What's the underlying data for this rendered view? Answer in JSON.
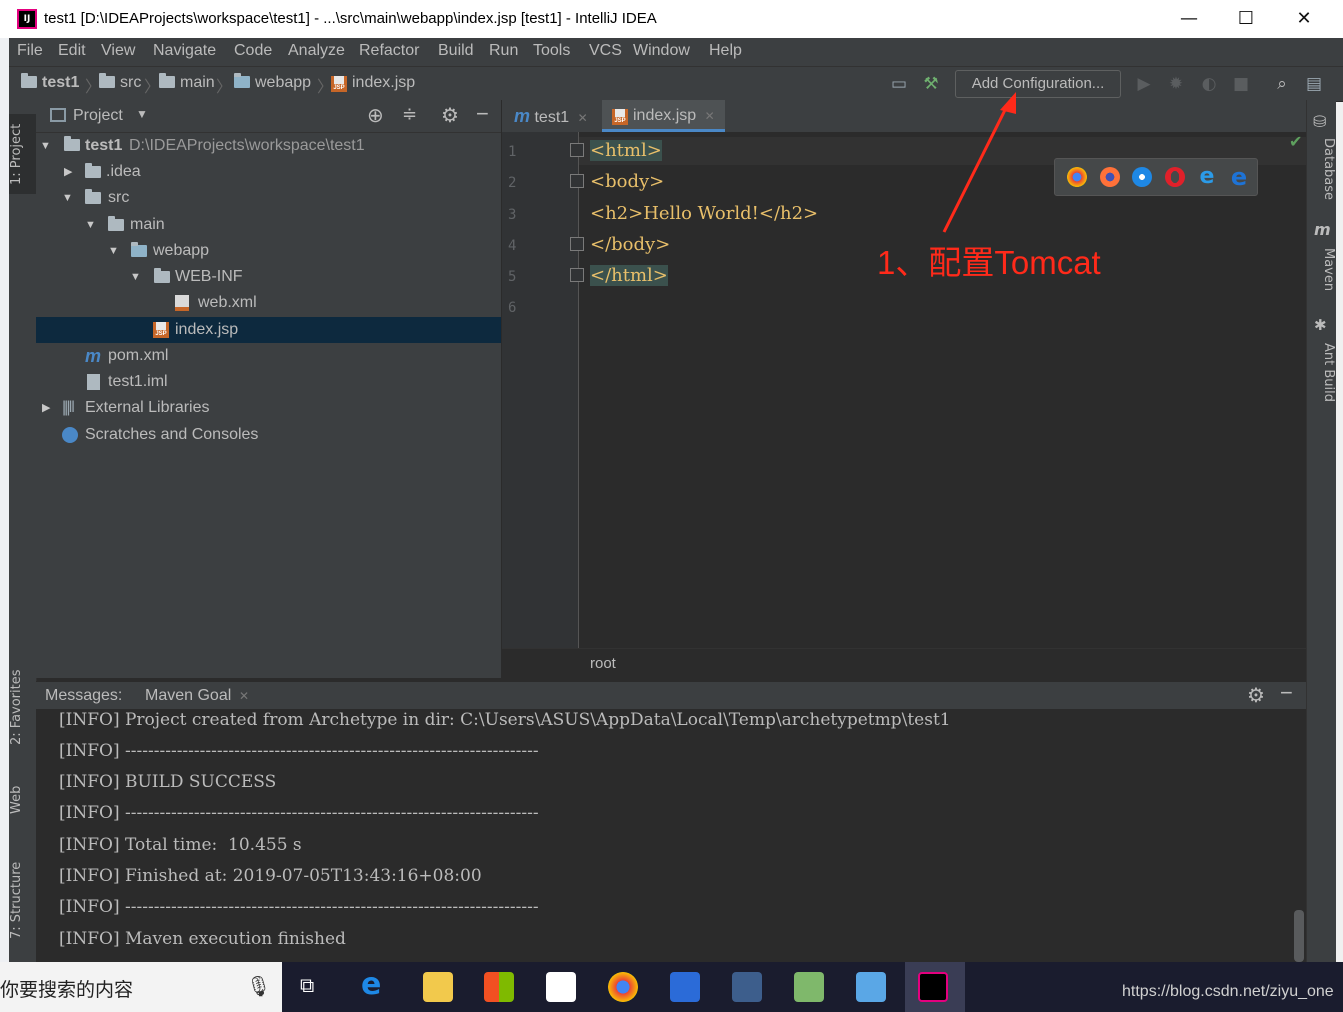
{
  "window": {
    "title": "test1 [D:\\IDEAProjects\\workspace\\test1] - ...\\src\\main\\webapp\\index.jsp [test1] - IntelliJ IDEA",
    "app_icon_label": "IJ",
    "minimize": "—",
    "maximize": "☐",
    "close": "✕"
  },
  "menu": [
    "File",
    "Edit",
    "View",
    "Navigate",
    "Code",
    "Analyze",
    "Refactor",
    "Build",
    "Run",
    "Tools",
    "VCS",
    "Window",
    "Help"
  ],
  "breadcrumb": [
    "test1",
    "src",
    "main",
    "webapp",
    "index.jsp"
  ],
  "toolbar": {
    "add_configuration": "Add Configuration..."
  },
  "left_tool_tabs": [
    "1: Project",
    "2: Favorites",
    "Web",
    "7: Structure"
  ],
  "right_tool_tabs": [
    "Database",
    "Maven",
    "Ant Build"
  ],
  "project_panel": {
    "title": "Project",
    "tree": [
      {
        "label": "test1",
        "path": "D:\\IDEAProjects\\workspace\\test1"
      },
      {
        "label": ".idea"
      },
      {
        "label": "src"
      },
      {
        "label": "main"
      },
      {
        "label": "webapp"
      },
      {
        "label": "WEB-INF"
      },
      {
        "label": "web.xml"
      },
      {
        "label": "index.jsp"
      },
      {
        "label": "pom.xml"
      },
      {
        "label": "test1.iml"
      },
      {
        "label": "External Libraries"
      },
      {
        "label": "Scratches and Consoles"
      }
    ]
  },
  "editor": {
    "tabs": [
      {
        "label": "test1",
        "icon": "maven-m-icon"
      },
      {
        "label": "index.jsp",
        "icon": "jsp-file-icon",
        "active": true
      }
    ],
    "line_numbers": [
      "1",
      "2",
      "3",
      "4",
      "5",
      "6"
    ],
    "lines": [
      "<html>",
      "<body>",
      "<h2>Hello World!</h2>",
      "</body>",
      "</html>",
      ""
    ],
    "breadcrumb": "root"
  },
  "annotation": "1、配置Tomcat",
  "messages": {
    "label": "Messages:",
    "tab": "Maven Goal",
    "lines": [
      "[INFO] Project created from Archetype in dir: C:\\Users\\ASUS\\AppData\\Local\\Temp\\archetypetmp\\test1",
      "[INFO] ------------------------------------------------------------------------",
      "[INFO] BUILD SUCCESS",
      "[INFO] ------------------------------------------------------------------------",
      "[INFO] Total time:  10.455 s",
      "[INFO] Finished at: 2019-07-05T13:43:16+08:00",
      "[INFO] ------------------------------------------------------------------------",
      "[INFO] Maven execution finished"
    ]
  },
  "taskbar": {
    "search_placeholder": "你要搜索的内容",
    "watermark": "https://blog.csdn.net/ziyu_one"
  },
  "colors": {
    "accent": "#4a88c7",
    "annotation_red": "#ff2a1a",
    "selection": "#0d293e"
  }
}
